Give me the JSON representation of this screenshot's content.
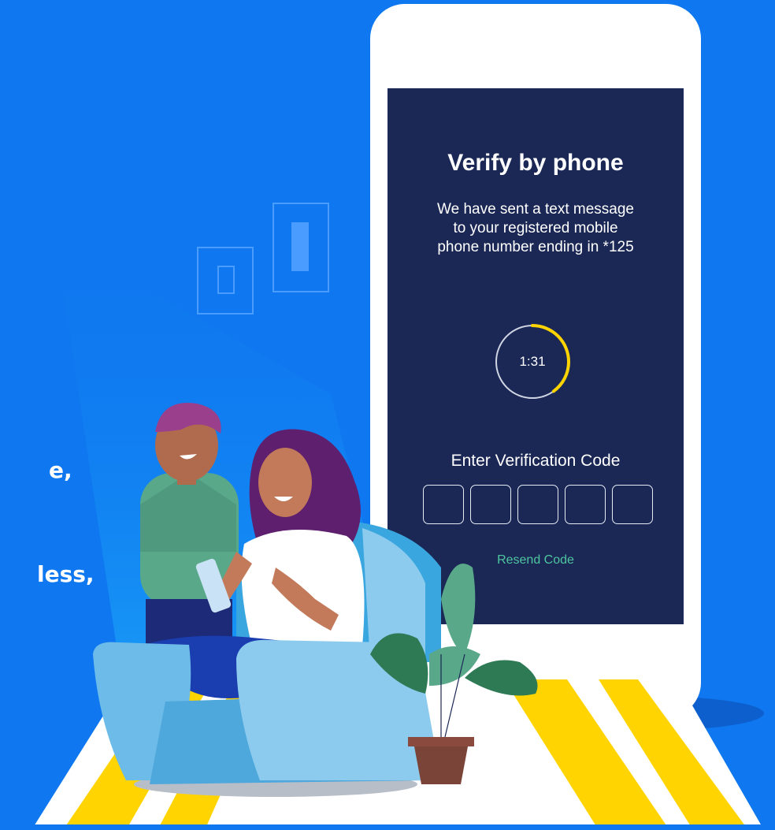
{
  "colors": {
    "background": "#0f78f0",
    "screen": "#1b2856",
    "timer_accent": "#ffd400",
    "resend": "#4fc59f",
    "rug_stripe": "#ffd400"
  },
  "side_text": {
    "line1": "e,",
    "line2": "less,"
  },
  "verify": {
    "title": "Verify by phone",
    "message": "We have sent a text message to your registered mobile phone number ending in *125",
    "timer": "1:31",
    "timer_progress": 0.4,
    "code_label": "Enter Verification Code",
    "code_boxes": [
      "",
      "",
      "",
      "",
      ""
    ],
    "resend_label": "Resend Code"
  },
  "illustration": {
    "icons": [
      "picture-frame-icon",
      "picture-frame-icon",
      "man-figure",
      "woman-figure",
      "armchair",
      "potted-plant",
      "striped-rug"
    ]
  }
}
